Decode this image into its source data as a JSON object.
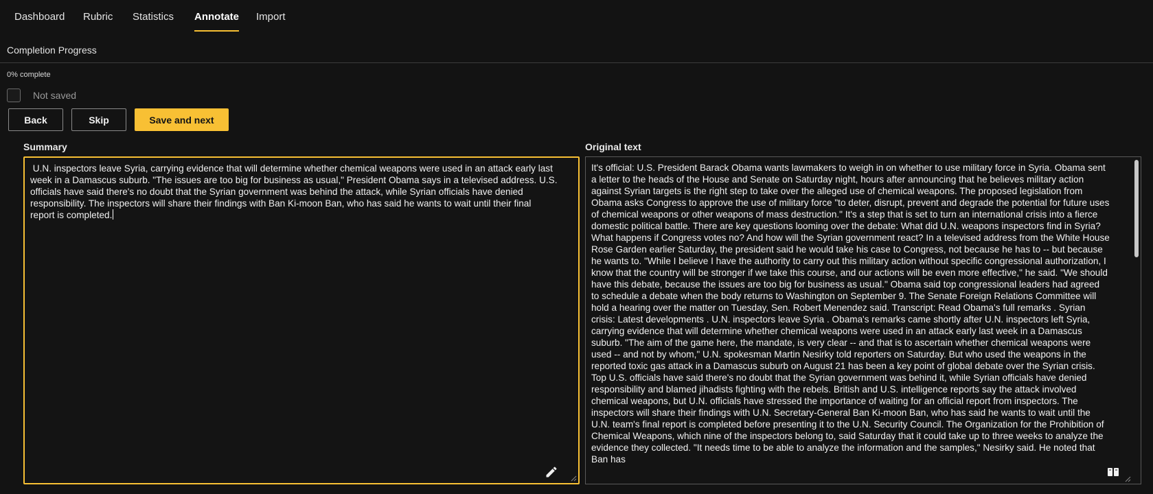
{
  "nav": {
    "tabs": [
      {
        "label": "Dashboard"
      },
      {
        "label": "Rubric"
      },
      {
        "label": "Statistics"
      },
      {
        "label": "Annotate",
        "active": true
      },
      {
        "label": "Import"
      }
    ]
  },
  "progress": {
    "title": "Completion Progress",
    "percent_text": "0% complete",
    "value": 0
  },
  "save_status": {
    "label": "Not saved",
    "checked": false
  },
  "actions": {
    "back_label": "Back",
    "skip_label": "Skip",
    "save_next_label": "Save and next"
  },
  "summary": {
    "label": "Summary",
    "text": " U.N. inspectors leave Syria, carrying evidence that will determine whether chemical weapons were used in an attack early last week in a Damascus suburb. \"The issues are too big for business as usual,\" President Obama says in a televised address. U.S. officials have said there's no doubt that the Syrian government was behind the attack, while Syrian officials have denied responsibility. The inspectors will share their findings with Ban Ki-moon Ban, who has said he wants to wait until their final report is completed."
  },
  "original": {
    "label": "Original text",
    "text": "It's official: U.S. President Barack Obama wants lawmakers to weigh in on whether to use military force in Syria. Obama sent a letter to the heads of the House and Senate on Saturday night, hours after announcing that he believes military action against Syrian targets is the right step to take over the alleged use of chemical weapons. The proposed legislation from Obama asks Congress to approve the use of military force \"to deter, disrupt, prevent and degrade the potential for future uses of chemical weapons or other weapons of mass destruction.\" It's a step that is set to turn an international crisis into a fierce domestic political battle. There are key questions looming over the debate: What did U.N. weapons inspectors find in Syria? What happens if Congress votes no? And how will the Syrian government react? In a televised address from the White House Rose Garden earlier Saturday, the president said he would take his case to Congress, not because he has to -- but because he wants to. \"While I believe I have the authority to carry out this military action without specific congressional authorization, I know that the country will be stronger if we take this course, and our actions will be even more effective,\" he said. \"We should have this debate, because the issues are too big for business as usual.\" Obama said top congressional leaders had agreed to schedule a debate when the body returns to Washington on September 9. The Senate Foreign Relations Committee will hold a hearing over the matter on Tuesday, Sen. Robert Menendez said. Transcript: Read Obama's full remarks . Syrian crisis: Latest developments . U.N. inspectors leave Syria . Obama's remarks came shortly after U.N. inspectors left Syria, carrying evidence that will determine whether chemical weapons were used in an attack early last week in a Damascus suburb. \"The aim of the game here, the mandate, is very clear -- and that is to ascertain whether chemical weapons were used -- and not by whom,\" U.N. spokesman Martin Nesirky told reporters on Saturday. But who used the weapons in the reported toxic gas attack in a Damascus suburb on August 21 has been a key point of global debate over the Syrian crisis. Top U.S. officials have said there's no doubt that the Syrian government was behind it, while Syrian officials have denied responsibility and blamed jihadists fighting with the rebels. British and U.S. intelligence reports say the attack involved chemical weapons, but U.N. officials have stressed the importance of waiting for an official report from inspectors. The inspectors will share their findings with U.N. Secretary-General Ban Ki-moon Ban, who has said he wants to wait until the U.N. team's final report is completed before presenting it to the U.N. Security Council. The Organization for the Prohibition of Chemical Weapons, which nine of the inspectors belong to, said Saturday that it could take up to three weeks to analyze the evidence they collected. \"It needs time to be able to analyze the information and the samples,\" Nesirky said. He noted that Ban has"
  },
  "icons": {
    "edit": "pencil-icon",
    "reader": "book-icon"
  },
  "colors": {
    "accent": "#f8c034",
    "background": "#131313",
    "border": "#5a5a5a"
  }
}
